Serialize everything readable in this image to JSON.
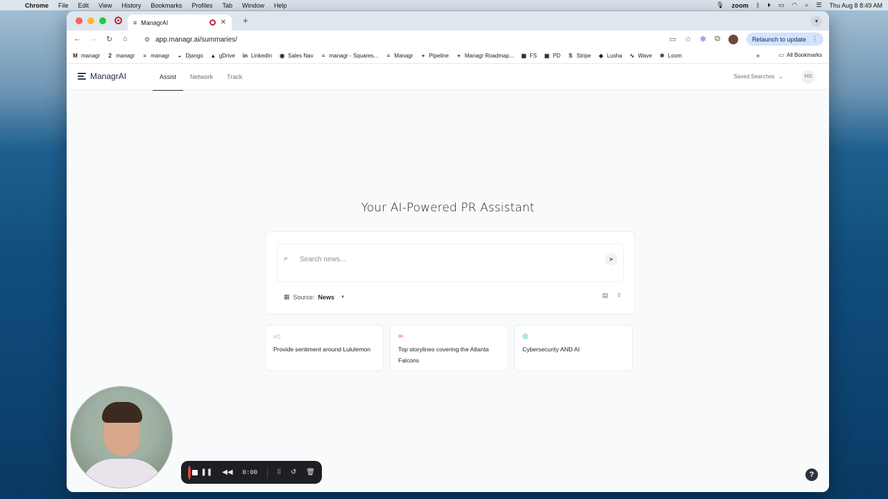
{
  "menubar": {
    "apple_icon": "apple-icon",
    "items": [
      "Chrome",
      "File",
      "Edit",
      "View",
      "History",
      "Bookmarks",
      "Profiles",
      "Tab",
      "Window",
      "Help"
    ],
    "zoom_label": "zoom",
    "datetime": "Thu Aug 8  8:49 AM"
  },
  "browser": {
    "tab_title": "ManagrAI",
    "url": "app.managr.ai/summaries/",
    "relaunch_label": "Relaunch to update",
    "bookmarks": [
      {
        "label": "managr",
        "icon": "M"
      },
      {
        "label": "managr",
        "icon": "2"
      },
      {
        "label": "managr",
        "icon": "≡"
      },
      {
        "label": "Django",
        "icon": "◒"
      },
      {
        "label": "gDrive",
        "icon": "▲"
      },
      {
        "label": "LinkedIn",
        "icon": "in"
      },
      {
        "label": "Sales Nav",
        "icon": "◉"
      },
      {
        "label": "managr - Squares...",
        "icon": "≡"
      },
      {
        "label": "Managr",
        "icon": "≡"
      },
      {
        "label": "Pipeline",
        "icon": "+"
      },
      {
        "label": "Managr Roadmap...",
        "icon": "+"
      },
      {
        "label": "FS",
        "icon": "▦"
      },
      {
        "label": "PD",
        "icon": "▣"
      },
      {
        "label": "Stripe",
        "icon": "S"
      },
      {
        "label": "Lusha",
        "icon": "◆"
      },
      {
        "label": "Wave",
        "icon": "∿"
      },
      {
        "label": "Loom",
        "icon": "✻"
      }
    ],
    "all_bookmarks_label": "All Bookmarks"
  },
  "app": {
    "logo_text": "ManagrAI",
    "nav": [
      {
        "label": "Assist",
        "active": true
      },
      {
        "label": "Network",
        "active": false
      },
      {
        "label": "Track",
        "active": false
      }
    ],
    "saved_searches_label": "Saved Searches",
    "user_initials": "MG",
    "hero_title": "Your AI-Powered PR Assistant",
    "search": {
      "placeholder": "Search news...",
      "value": ""
    },
    "source": {
      "label": "Source:",
      "value": "News"
    },
    "suggestions": [
      {
        "icon": "thumbs-up-icon",
        "glyph": "👍",
        "color": "#9ca3af",
        "text": "Provide sentiment around Lululemon"
      },
      {
        "icon": "glasses-icon",
        "glyph": "∞",
        "color": "#e0457b",
        "text": "Top storylines covering the Atlanta Falcons"
      },
      {
        "icon": "target-icon",
        "glyph": "◎",
        "color": "#19a7b5",
        "text": "Cybersecurity AND AI"
      }
    ],
    "help_label": "?"
  },
  "recorder": {
    "time": "0:00"
  }
}
